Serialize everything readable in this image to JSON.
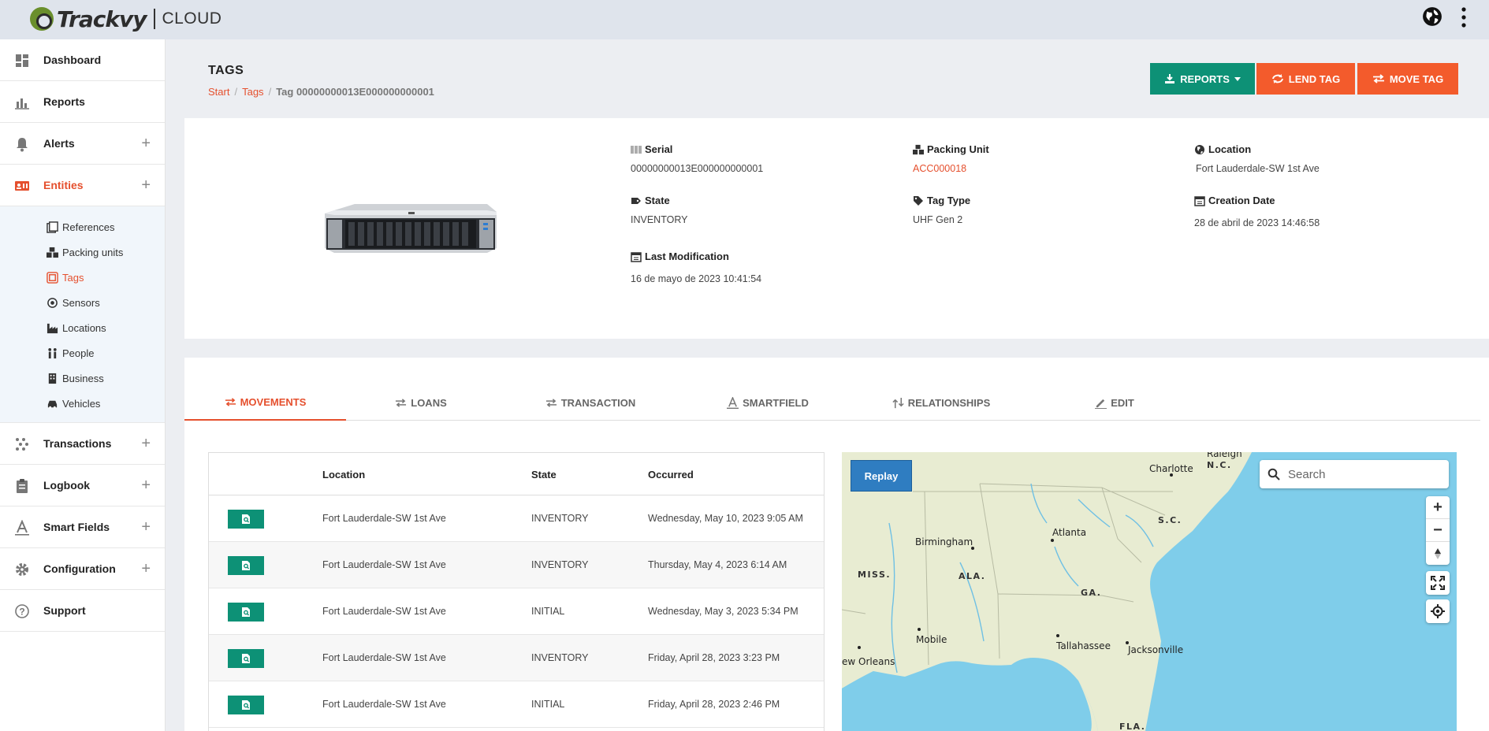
{
  "app": {
    "logo_text": "Trackvy",
    "logo_sub": "CLOUD"
  },
  "topbar": {
    "globe_icon": "globe-icon",
    "menu_icon": "kebab-menu-icon"
  },
  "sidebar": {
    "items": [
      {
        "label": "Dashboard",
        "icon": "dashboard-icon"
      },
      {
        "label": "Reports",
        "icon": "bar-chart-icon"
      },
      {
        "label": "Alerts",
        "icon": "bell-icon",
        "expand": "+"
      },
      {
        "label": "Entities",
        "icon": "id-card-icon",
        "expand": "+",
        "active": true
      },
      {
        "label": "Transactions",
        "icon": "transactions-icon",
        "expand": "+"
      },
      {
        "label": "Logbook",
        "icon": "clipboard-icon",
        "expand": "+"
      },
      {
        "label": "Smart Fields",
        "icon": "smartfield-icon",
        "expand": "+"
      },
      {
        "label": "Configuration",
        "icon": "gear-icon",
        "expand": "+"
      },
      {
        "label": "Support",
        "icon": "question-icon"
      }
    ],
    "entities_sub": [
      {
        "label": "References",
        "icon": "reference-icon"
      },
      {
        "label": "Packing units",
        "icon": "boxes-icon"
      },
      {
        "label": "Tags",
        "icon": "tag-icon",
        "active": true
      },
      {
        "label": "Sensors",
        "icon": "sensor-icon"
      },
      {
        "label": "Locations",
        "icon": "factory-icon"
      },
      {
        "label": "People",
        "icon": "people-icon"
      },
      {
        "label": "Business",
        "icon": "building-icon"
      },
      {
        "label": "Vehicles",
        "icon": "car-icon"
      }
    ]
  },
  "header": {
    "title": "TAGS",
    "breadcrumb": {
      "start": "Start",
      "tags": "Tags",
      "current": "Tag 00000000013E000000000001"
    },
    "buttons": {
      "reports": "REPORTS",
      "lend": "LEND TAG",
      "move": "MOVE TAG"
    }
  },
  "info": {
    "serial_label": "Serial",
    "serial_value": "00000000013E000000000001",
    "packing_label": "Packing Unit",
    "packing_value": "ACC000018",
    "location_label": "Location",
    "location_value": "Fort Lauderdale-SW 1st Ave",
    "state_label": "State",
    "state_value": "INVENTORY",
    "tagtype_label": "Tag Type",
    "tagtype_value": "UHF Gen 2",
    "creation_label": "Creation Date",
    "creation_value": "28 de abril de 2023 14:46:58",
    "lastmod_label": "Last Modification",
    "lastmod_value": "16 de mayo de 2023 10:41:54"
  },
  "tabs": {
    "movements": "MOVEMENTS",
    "loans": "LOANS",
    "transaction": "TRANSACTION",
    "smartfield": "SMARTFIELD",
    "relationships": "RELATIONSHIPS",
    "edit": "EDIT"
  },
  "table": {
    "headers": {
      "location": "Location",
      "state": "State",
      "occurred": "Occurred"
    },
    "rows": [
      {
        "location": "Fort Lauderdale-SW 1st Ave",
        "state": "INVENTORY",
        "occurred": "Wednesday, May 10, 2023 9:05 AM"
      },
      {
        "location": "Fort Lauderdale-SW 1st Ave",
        "state": "INVENTORY",
        "occurred": "Thursday, May 4, 2023 6:14 AM"
      },
      {
        "location": "Fort Lauderdale-SW 1st Ave",
        "state": "INITIAL",
        "occurred": "Wednesday, May 3, 2023 5:34 PM"
      },
      {
        "location": "Fort Lauderdale-SW 1st Ave",
        "state": "INVENTORY",
        "occurred": "Friday, April 28, 2023 3:23 PM"
      },
      {
        "location": "Fort Lauderdale-SW 1st Ave",
        "state": "INITIAL",
        "occurred": "Friday, April 28, 2023 2:46 PM"
      }
    ]
  },
  "map": {
    "replay": "Replay",
    "search_placeholder": "Search",
    "cities": {
      "charlotte": "Charlotte",
      "raleigh": "Raleigh",
      "birmingham": "Birmingham",
      "atlanta": "Atlanta",
      "mobile": "Mobile",
      "tallahassee": "Tallahassee",
      "jacksonville": "Jacksonville",
      "new_orleans": "ew Orleans"
    },
    "states": {
      "nc": "N.C.",
      "sc": "S.C.",
      "miss": "MISS.",
      "ala": "ALA.",
      "ga": "GA.",
      "fla": "FLA."
    },
    "colors": {
      "land": "#e8ecd2",
      "water": "#7fcdea"
    }
  },
  "colors": {
    "accent": "#e5502e",
    "teal": "#0d9176",
    "orange": "#f35b2c",
    "blue": "#2f7dc1"
  }
}
